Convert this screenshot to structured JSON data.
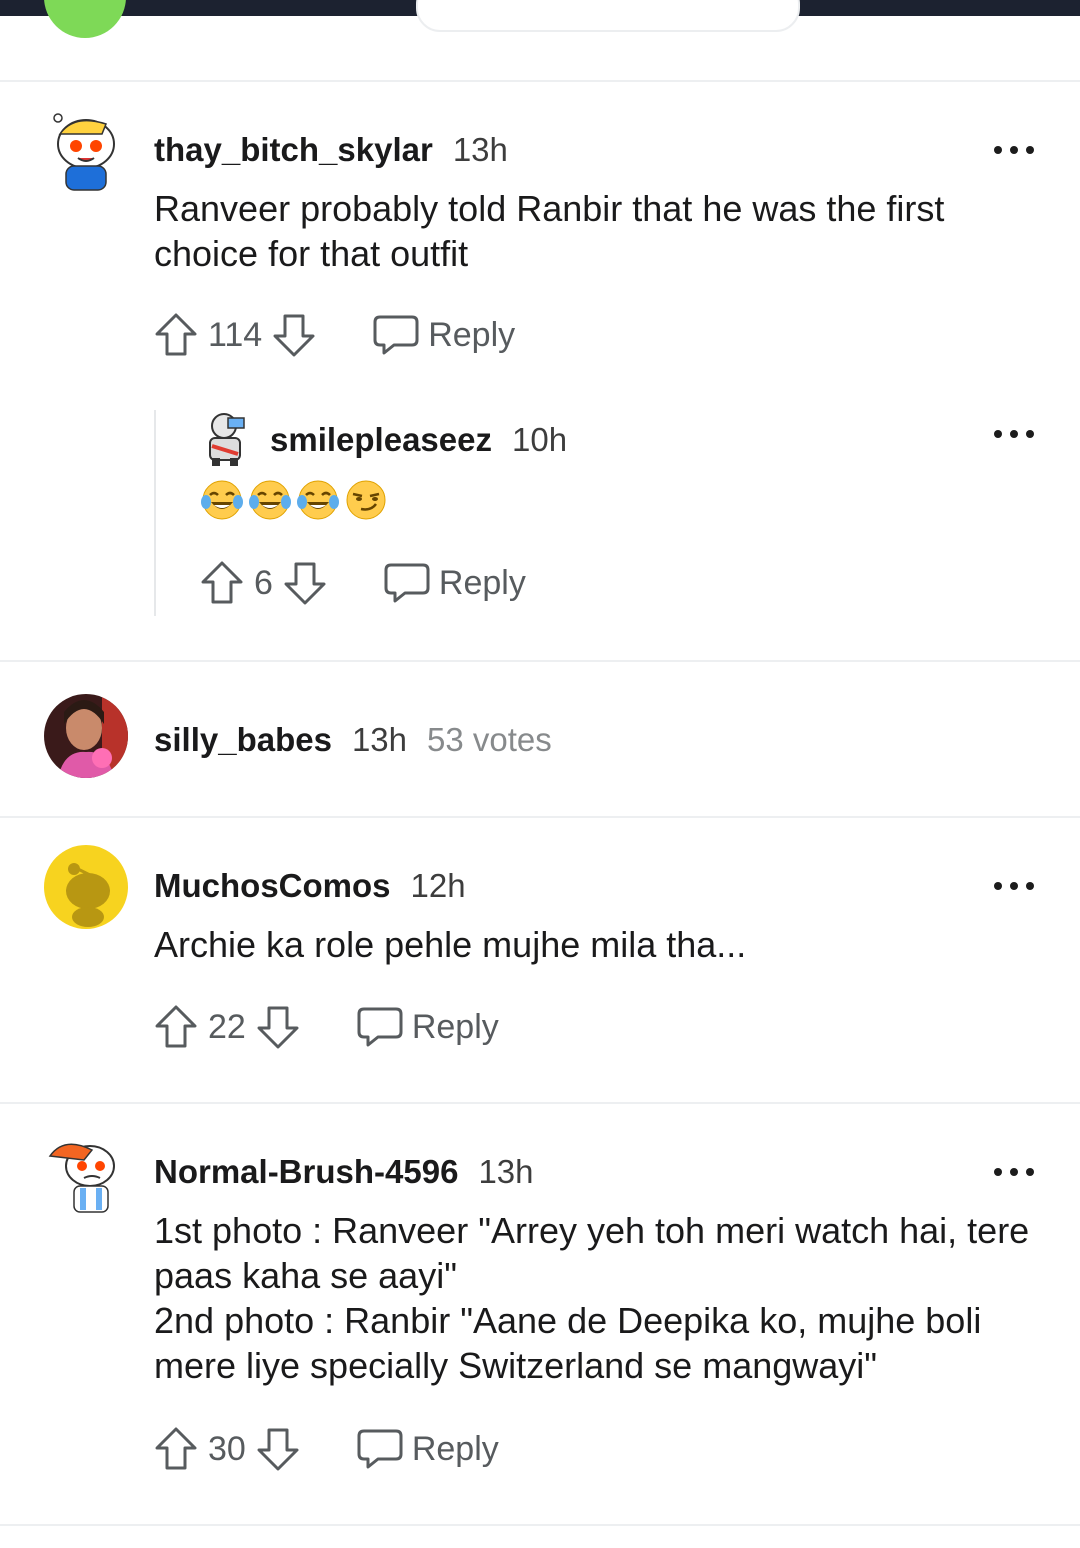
{
  "colors": {
    "background": "#ffffff",
    "text": "#1a1a1b",
    "muted": "#878a8c",
    "icon": "#575b5e",
    "divider": "#edeff1",
    "topbar": "#1c2230"
  },
  "comments": [
    {
      "username": "thay_bitch_skylar",
      "time": "13h",
      "body": [
        "Ranveer probably told Ranbir that he was the first choice for that outfit"
      ],
      "score": "114",
      "reply_label": "Reply",
      "replies": [
        {
          "username": "smilepleaseez",
          "time": "10h",
          "emojis": [
            "face-with-tears-of-joy",
            "face-with-tears-of-joy",
            "face-with-tears-of-joy",
            "smirking-face"
          ],
          "score": "6",
          "reply_label": "Reply"
        }
      ]
    },
    {
      "username": "silly_babes",
      "time": "13h",
      "votes_note": "53 votes"
    },
    {
      "username": "MuchosComos",
      "time": "12h",
      "body": [
        "Archie ka role pehle mujhe mila tha..."
      ],
      "score": "22",
      "reply_label": "Reply"
    },
    {
      "username": "Normal-Brush-4596",
      "time": "13h",
      "body": [
        "1st photo : Ranveer \"Arrey yeh toh meri watch hai, tere paas kaha se aayi\"",
        "2nd photo : Ranbir \"Aane de Deepika ko, mujhe boli mere liye specially Switzerland se mangwayi\""
      ],
      "score": "30",
      "reply_label": "Reply"
    }
  ]
}
